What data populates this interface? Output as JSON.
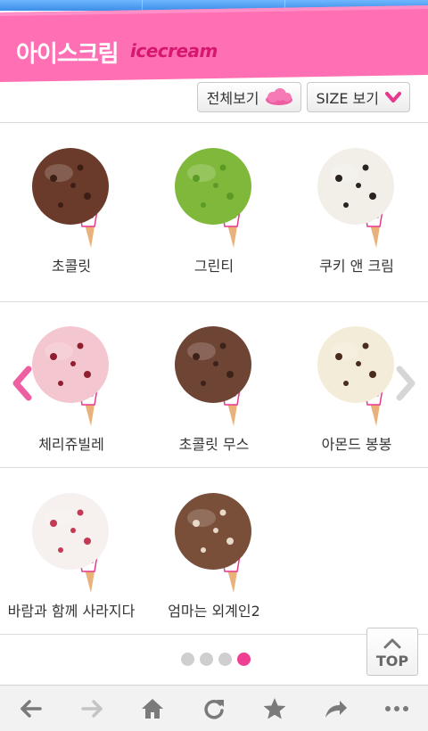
{
  "header": {
    "title_kr": "아이스크림",
    "title_en": "icecream",
    "accent_color": "#ff6fb4"
  },
  "filters": {
    "all_label": "전체보기",
    "all_icon": "cloud-icon",
    "size_label": "SIZE 보기",
    "size_icon": "chevron-down-icon"
  },
  "products": [
    {
      "name": "초콜릿",
      "flavor_color": "#6a3b2a",
      "chip_color": "#3b1e14"
    },
    {
      "name": "그린티",
      "flavor_color": "#7fb83a",
      "chip_color": "#5c9a26"
    },
    {
      "name": "쿠키 앤 크림",
      "flavor_color": "#f2efe8",
      "chip_color": "#2a2320"
    },
    {
      "name": "체리쥬빌레",
      "flavor_color": "#f4c6cf",
      "chip_color": "#8f1e2e"
    },
    {
      "name": "초콜릿 무스",
      "flavor_color": "#6e4434",
      "chip_color": "#3d2219"
    },
    {
      "name": "아몬드 봉봉",
      "flavor_color": "#f3ecd8",
      "chip_color": "#4a2c1c"
    },
    {
      "name": "바람과 함께 사라지다",
      "flavor_color": "#f6f1ee",
      "chip_color": "#c43a55"
    },
    {
      "name": "엄마는 외계인2",
      "flavor_color": "#7a4f3a",
      "chip_color": "#e8d9c8"
    }
  ],
  "pagination": {
    "total_pages": 4,
    "current_page": 4
  },
  "top_button": {
    "label": "TOP"
  },
  "bottom_nav": [
    {
      "icon": "back-arrow-icon"
    },
    {
      "icon": "forward-arrow-icon"
    },
    {
      "icon": "home-icon"
    },
    {
      "icon": "refresh-icon"
    },
    {
      "icon": "star-icon"
    },
    {
      "icon": "share-icon"
    },
    {
      "icon": "more-icon"
    }
  ]
}
